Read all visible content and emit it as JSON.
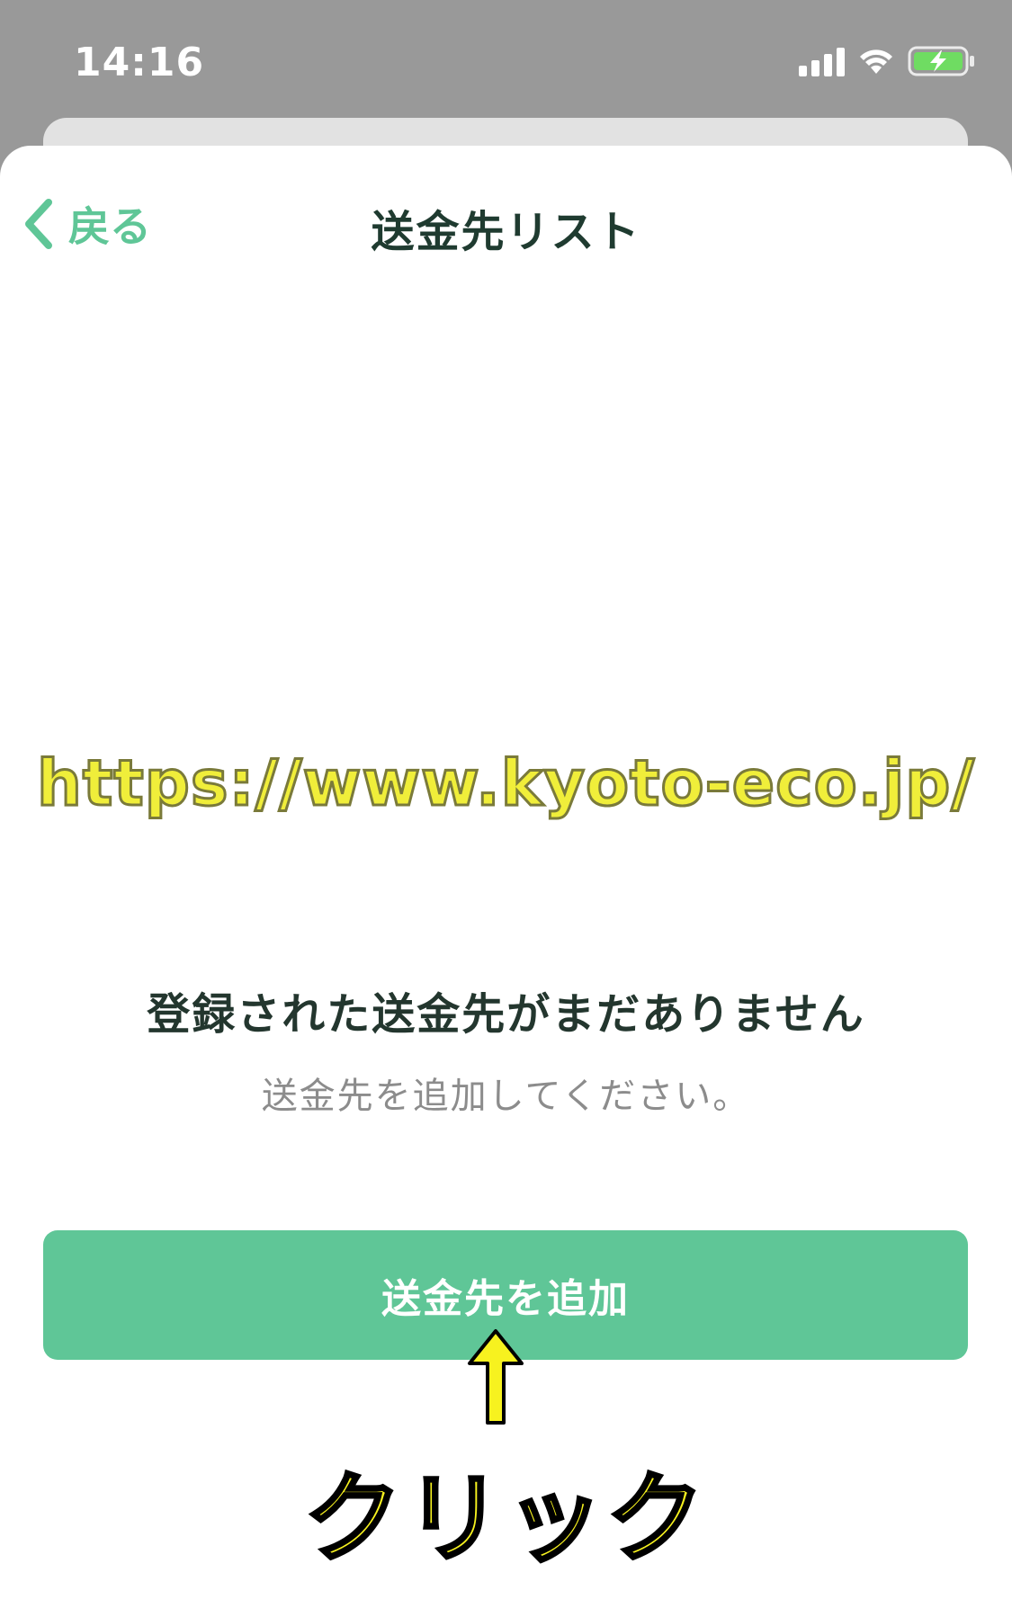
{
  "status_bar": {
    "time": "14:16"
  },
  "nav": {
    "back_label": "戻る",
    "title": "送金先リスト"
  },
  "overlay": {
    "url_watermark": "https://www.kyoto-eco.jp/",
    "annotation_label": "クリック"
  },
  "empty_state": {
    "title": "登録された送金先がまだありません",
    "subtitle": "送金先を追加してください。"
  },
  "primary_button": {
    "label": "送金先を追加"
  },
  "colors": {
    "accent": "#5fc697",
    "title_text": "#1f3b30",
    "subtitle_text": "#8c8c8c",
    "annotation_yellow": "#f7f21f"
  },
  "icons": {
    "back": "chevron-left-icon",
    "signal": "signal-icon",
    "wifi": "wifi-icon",
    "battery": "battery-charging-icon",
    "annotation_arrow": "arrow-up-icon"
  }
}
